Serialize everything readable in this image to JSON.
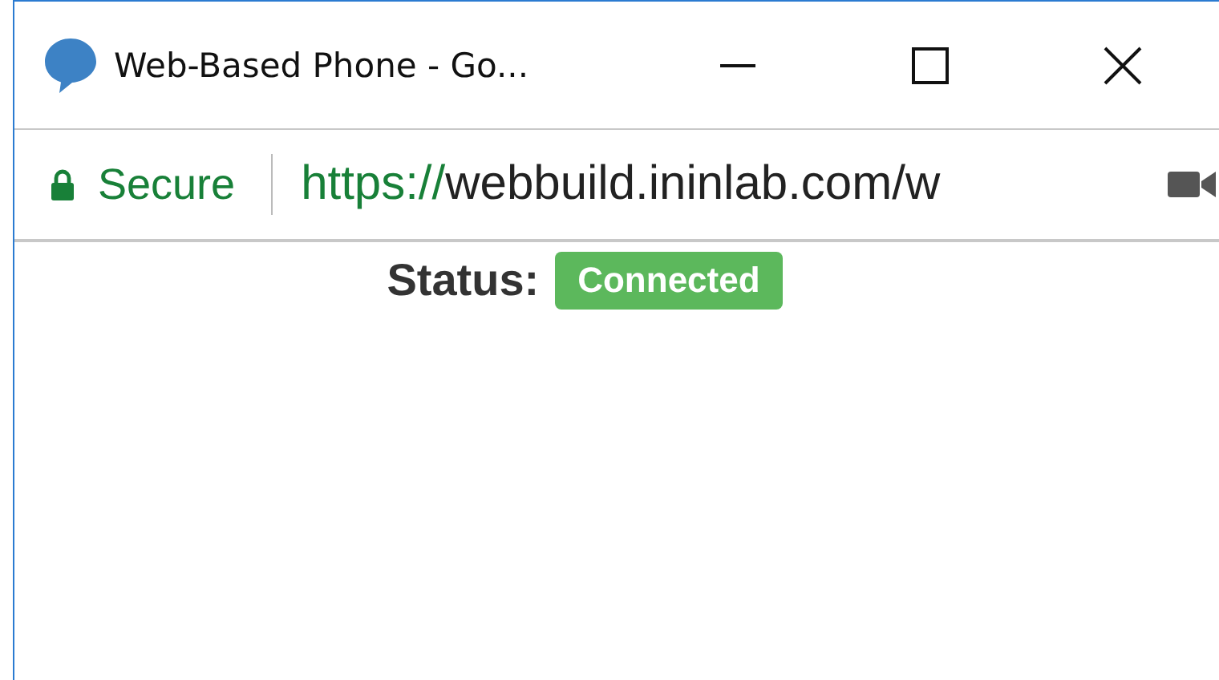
{
  "window": {
    "title": "Web-Based Phone - Go..."
  },
  "address_bar": {
    "security": "Secure",
    "url_scheme": "https://",
    "url_rest": "webbuild.ininlab.com/w"
  },
  "status": {
    "label": "Status:",
    "value": "Connected"
  }
}
